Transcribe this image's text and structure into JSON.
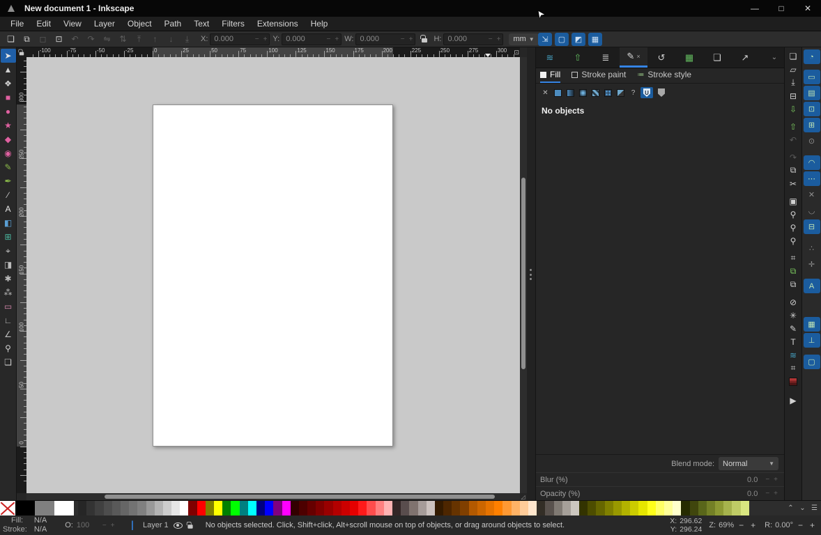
{
  "window": {
    "title": "New document 1 - Inkscape",
    "controls": [
      {
        "name": "minimize-button",
        "glyph": "—"
      },
      {
        "name": "maximize-button",
        "glyph": "□"
      },
      {
        "name": "close-button",
        "glyph": "✕"
      }
    ]
  },
  "menubar": {
    "items": [
      "File",
      "Edit",
      "View",
      "Layer",
      "Object",
      "Path",
      "Text",
      "Filters",
      "Extensions",
      "Help"
    ]
  },
  "toolbar": {
    "buttons": [
      {
        "name": "select-all-button",
        "glyph": "❏",
        "enabled": true
      },
      {
        "name": "select-all-layers-button",
        "glyph": "⧉",
        "enabled": true
      },
      {
        "name": "deselect-button",
        "glyph": "◻",
        "enabled": false
      },
      {
        "name": "select-touch-button",
        "glyph": "⊡",
        "enabled": true
      },
      {
        "name": "rotate-ccw-button",
        "glyph": "↶",
        "enabled": false
      },
      {
        "name": "rotate-cw-button",
        "glyph": "↷",
        "enabled": false
      },
      {
        "name": "flip-horizontal-button",
        "glyph": "⇋",
        "enabled": false
      },
      {
        "name": "flip-vertical-button",
        "glyph": "⇅",
        "enabled": false
      },
      {
        "name": "raise-top-button",
        "glyph": "⤒",
        "enabled": false
      },
      {
        "name": "raise-button",
        "glyph": "↑",
        "enabled": false
      },
      {
        "name": "lower-button",
        "glyph": "↓",
        "enabled": false
      },
      {
        "name": "lower-bottom-button",
        "glyph": "⤓",
        "enabled": false
      }
    ],
    "x_label": "X:",
    "x_value": "0.000",
    "y_label": "Y:",
    "y_value": "0.000",
    "w_label": "W:",
    "w_value": "0.000",
    "h_label": "H:",
    "h_value": "0.000",
    "units": "mm",
    "transform_toggles": [
      {
        "name": "scale-stroke-toggle",
        "glyph": "⇲"
      },
      {
        "name": "scale-corners-toggle",
        "glyph": "▢"
      },
      {
        "name": "move-gradients-toggle",
        "glyph": "◩"
      },
      {
        "name": "move-patterns-toggle",
        "glyph": "▦"
      }
    ]
  },
  "toolbox": {
    "tools": [
      {
        "name": "selector-tool",
        "glyph": "➤",
        "color": "#e3e3e3",
        "active": true
      },
      {
        "name": "node-editor-tool",
        "glyph": "▲",
        "color": "#d0d0d0",
        "active": false
      },
      {
        "name": "shape-builder-tool",
        "glyph": "❖",
        "color": "#d0d0d0",
        "active": false
      },
      {
        "name": "rectangle-tool",
        "glyph": "■",
        "color": "#e061a1",
        "active": false
      },
      {
        "name": "ellipse-tool",
        "glyph": "●",
        "color": "#e061a1",
        "active": false
      },
      {
        "name": "star-tool",
        "glyph": "★",
        "color": "#e061a1",
        "active": false
      },
      {
        "name": "box-3d-tool",
        "glyph": "◆",
        "color": "#e061a1",
        "active": false
      },
      {
        "name": "spiral-tool",
        "glyph": "◉",
        "color": "#e061a1",
        "active": false
      },
      {
        "name": "pencil-tool",
        "glyph": "✎",
        "color": "#8ab94a",
        "active": false
      },
      {
        "name": "pen-tool",
        "glyph": "✒",
        "color": "#8ab94a",
        "active": false
      },
      {
        "name": "calligraphy-tool",
        "glyph": "∕",
        "color": "#d0d0d0",
        "active": false
      },
      {
        "name": "text-tool",
        "glyph": "A",
        "color": "#e8e8e8",
        "active": false
      },
      {
        "name": "gradient-tool",
        "glyph": "◧",
        "color": "#5a9fd4",
        "active": false
      },
      {
        "name": "mesh-tool",
        "glyph": "⊞",
        "color": "#4ab9a0",
        "active": false
      },
      {
        "name": "dropper-tool",
        "glyph": "⌖",
        "color": "#d0d0d0",
        "active": false
      },
      {
        "name": "paint-bucket-tool",
        "glyph": "◨",
        "color": "#bcbcbc",
        "active": false
      },
      {
        "name": "tweak-tool",
        "glyph": "✱",
        "color": "#bcbcbc",
        "active": false
      },
      {
        "name": "spray-tool",
        "glyph": "⁂",
        "color": "#bcbcbc",
        "active": false
      },
      {
        "name": "eraser-tool",
        "glyph": "▭",
        "color": "#d78ab0",
        "active": false
      },
      {
        "name": "connector-tool",
        "glyph": "∟",
        "color": "#bcbcbc",
        "active": false
      },
      {
        "name": "measure-tool",
        "glyph": "∠",
        "color": "#bcbcbc",
        "active": false
      },
      {
        "name": "zoom-tool",
        "glyph": "⚲",
        "color": "#d0d0d0",
        "active": false
      },
      {
        "name": "pages-tool",
        "glyph": "❏",
        "color": "#d0d0d0",
        "active": false
      }
    ]
  },
  "rulers": {
    "unit": "mm",
    "h_labels": [
      "-100",
      "-75",
      "-50",
      "-25",
      "0",
      "25",
      "50",
      "75",
      "100",
      "125",
      "150",
      "175",
      "200",
      "225",
      "250",
      "275",
      "300"
    ],
    "v_labels": [
      "300",
      "250",
      "200",
      "150",
      "100",
      "50",
      "0"
    ]
  },
  "dock": {
    "dialog_tabs": [
      {
        "name": "tab-objects-dialog",
        "glyph": "≋",
        "color": "#46a0c0",
        "active": false
      },
      {
        "name": "tab-export-dialog",
        "glyph": "⇧",
        "color": "#62b95e",
        "active": false
      },
      {
        "name": "tab-align-distribute-dialog",
        "glyph": "≣",
        "color": "#d0d0d0",
        "active": false
      },
      {
        "name": "tab-fill-stroke-dialog",
        "glyph": "✎",
        "color": "#d8d8d8",
        "active": true,
        "closable": true
      },
      {
        "name": "tab-undo-history-dialog",
        "glyph": "↺",
        "color": "#d0d0d0",
        "active": false
      },
      {
        "name": "tab-transform-dialog",
        "glyph": "▦",
        "color": "#62b95e",
        "active": false
      },
      {
        "name": "tab-document-properties-dialog",
        "glyph": "❏",
        "color": "#d0d0d0",
        "active": false
      },
      {
        "name": "tab-symbols-dialog",
        "glyph": "↗",
        "color": "#d0d0d0",
        "active": false
      }
    ],
    "close_glyph": "×",
    "more_tabs_glyph": "⌄",
    "fill_stroke": {
      "tabs": [
        {
          "name": "tab-fill",
          "label": "Fill",
          "active": true,
          "icon": "filled-square-icon"
        },
        {
          "name": "tab-stroke-paint",
          "label": "Stroke paint",
          "active": false,
          "icon": "outline-square-icon"
        },
        {
          "name": "tab-stroke-style",
          "label": "Stroke style",
          "active": false,
          "icon": "stroke-lines-icon"
        }
      ],
      "paint_buttons": [
        {
          "name": "paint-none-button",
          "kind": "glyph",
          "glyph": "✕"
        },
        {
          "name": "paint-flat-button",
          "kind": "swatch",
          "css": "pb-flat"
        },
        {
          "name": "paint-linear-gradient-button",
          "kind": "swatch",
          "css": "pb-lin"
        },
        {
          "name": "paint-radial-gradient-button",
          "kind": "swatch",
          "css": "pb-rad"
        },
        {
          "name": "paint-pattern-button",
          "kind": "swatch",
          "css": "pb-pat"
        },
        {
          "name": "paint-mesh-gradient-button",
          "kind": "swatch",
          "css": "pb-mesh"
        },
        {
          "name": "paint-swatch-button",
          "kind": "swatch",
          "css": "pb-sw"
        },
        {
          "name": "paint-unknown-button",
          "kind": "glyph",
          "glyph": "?"
        },
        {
          "name": "fill-rule-evenodd-button",
          "kind": "shield",
          "glyph": "U",
          "active": true
        },
        {
          "name": "fill-rule-nonzero-button",
          "kind": "shield",
          "glyph": "",
          "active": false
        }
      ],
      "message": "No objects",
      "blend_mode_label": "Blend mode:",
      "blend_mode_value": "Normal",
      "blur_label": "Blur (%)",
      "blur_value": "0.0",
      "opacity_label": "Opacity (%)",
      "opacity_value": "0.0"
    }
  },
  "commands_bar": {
    "buttons": [
      {
        "name": "new-document-button",
        "glyph": "❏",
        "enabled": true
      },
      {
        "name": "open-document-button",
        "glyph": "▱",
        "enabled": true
      },
      {
        "name": "save-document-button",
        "glyph": "⤓",
        "enabled": true
      },
      {
        "name": "print-button",
        "glyph": "⊟",
        "enabled": true
      },
      {
        "name": "import-button",
        "glyph": "⇩",
        "enabled": true,
        "color": "#7bc95e"
      },
      {
        "name": "export-button",
        "glyph": "⇧",
        "enabled": true,
        "color": "#7bc95e",
        "gap": 6
      },
      {
        "name": "undo-button",
        "glyph": "↶",
        "enabled": false
      },
      {
        "name": "redo-button",
        "glyph": "↷",
        "enabled": false,
        "gap": 6
      },
      {
        "name": "copy-button",
        "glyph": "⧉",
        "enabled": true
      },
      {
        "name": "cut-button",
        "glyph": "✂",
        "enabled": true
      },
      {
        "name": "paste-button",
        "glyph": "▣",
        "enabled": true,
        "gap": 6
      },
      {
        "name": "zoom-selection-button",
        "glyph": "⚲",
        "enabled": true
      },
      {
        "name": "zoom-drawing-button",
        "glyph": "⚲",
        "enabled": true
      },
      {
        "name": "zoom-page-button",
        "glyph": "⚲",
        "enabled": true
      },
      {
        "name": "zoom-center-page-button",
        "glyph": "⌗",
        "enabled": true,
        "gap": 6
      },
      {
        "name": "duplicate-button",
        "glyph": "⧉",
        "enabled": true,
        "color": "#7bc95e"
      },
      {
        "name": "create-clone-button",
        "glyph": "⧉",
        "enabled": true
      },
      {
        "name": "unlink-clone-button",
        "glyph": "⊘",
        "enabled": true,
        "gap": 6
      },
      {
        "name": "preferences-button",
        "glyph": "✳",
        "enabled": true
      },
      {
        "name": "fill-stroke-dialog-button",
        "glyph": "✎",
        "enabled": true
      },
      {
        "name": "text-dialog-button",
        "glyph": "T",
        "enabled": true
      },
      {
        "name": "layers-dialog-button",
        "glyph": "≋",
        "enabled": true,
        "color": "#46a0c0"
      },
      {
        "name": "xml-editor-button",
        "glyph": "⌗",
        "enabled": true
      },
      {
        "name": "swatches-dialog-button",
        "glyph": "",
        "enabled": true,
        "css": "sw-colored"
      },
      {
        "name": "expand-commands-button",
        "glyph": "▶",
        "enabled": true,
        "gap": 8
      }
    ]
  },
  "snap_bar": {
    "buttons": [
      {
        "name": "snap-global-toggle",
        "glyph": "◔",
        "active": true,
        "gap": 8
      },
      {
        "name": "snap-bounding-box-toggle",
        "glyph": "▭",
        "active": true
      },
      {
        "name": "snap-bbox-edges-toggle",
        "glyph": "▤",
        "active": true
      },
      {
        "name": "snap-bbox-corners-toggle",
        "glyph": "⊡",
        "active": true
      },
      {
        "name": "snap-bbox-midpoints-toggle",
        "glyph": "⊞",
        "active": true
      },
      {
        "name": "snap-bbox-centers-toggle",
        "glyph": "⊙",
        "active": false,
        "gap": 10
      },
      {
        "name": "snap-nodes-toggle",
        "glyph": "◠",
        "active": true
      },
      {
        "name": "snap-path-intersections-toggle",
        "glyph": "⋯",
        "active": true
      },
      {
        "name": "snap-cusp-nodes-toggle",
        "glyph": "✕",
        "active": false
      },
      {
        "name": "snap-smooth-nodes-toggle",
        "glyph": "◡",
        "active": false
      },
      {
        "name": "snap-line-midpoints-toggle",
        "glyph": "⊟",
        "active": true,
        "gap": 10
      },
      {
        "name": "snap-object-centers-toggle",
        "glyph": "∴",
        "active": false
      },
      {
        "name": "snap-rotation-centers-toggle",
        "glyph": "✛",
        "active": false,
        "gap": 10
      },
      {
        "name": "snap-text-baseline-toggle",
        "glyph": "A",
        "active": true,
        "gap": 34
      },
      {
        "name": "snap-grid-toggle",
        "glyph": "▦",
        "active": true
      },
      {
        "name": "snap-guides-toggle",
        "glyph": "⊥",
        "active": true,
        "gap": 10
      },
      {
        "name": "snap-page-border-toggle",
        "glyph": "▢",
        "active": true
      }
    ]
  },
  "palette": {
    "large_swatches": [
      "#000000",
      "#808080",
      "#ffffff"
    ],
    "colors": [
      "#262626",
      "#333333",
      "#404040",
      "#4d4d4d",
      "#595959",
      "#666666",
      "#737373",
      "#808080",
      "#999999",
      "#b3b3b3",
      "#cccccc",
      "#e6e6e6",
      "#ffffff",
      "#800000",
      "#ff0000",
      "#808000",
      "#ffff00",
      "#008000",
      "#00ff00",
      "#008080",
      "#00ffff",
      "#000080",
      "#0000ff",
      "#800080",
      "#ff00ff",
      "#330000",
      "#4d0000",
      "#660000",
      "#800000",
      "#990000",
      "#b30000",
      "#cc0000",
      "#e60000",
      "#ff1a1a",
      "#ff4d4d",
      "#ff8080",
      "#ffb3b3",
      "#332626",
      "#594d4d",
      "#80736f",
      "#a69c99",
      "#ccc2bf",
      "#331a00",
      "#4d2600",
      "#663300",
      "#803f00",
      "#b35900",
      "#cc6600",
      "#e67300",
      "#ff8000",
      "#ff9933",
      "#ffb366",
      "#ffcc99",
      "#ffe6cc",
      "#332e26",
      "#59524d",
      "#807a73",
      "#a6a099",
      "#ccc7bf",
      "#333300",
      "#4d4d00",
      "#666600",
      "#808000",
      "#999900",
      "#b3b300",
      "#cccc00",
      "#e6e600",
      "#ffff1a",
      "#ffff66",
      "#ffff99",
      "#ffffcc",
      "#262b00",
      "#40460d",
      "#59661a",
      "#738026",
      "#8c9933",
      "#a6b34d",
      "#bfcc66",
      "#d9e680"
    ],
    "controls": [
      {
        "name": "palette-scroll-up-button",
        "glyph": "⌃"
      },
      {
        "name": "palette-scroll-down-button",
        "glyph": "⌄"
      },
      {
        "name": "palette-menu-button",
        "glyph": "☰"
      }
    ]
  },
  "statusbar": {
    "fill_label": "Fill:",
    "fill_value": "N/A",
    "stroke_label": "Stroke:",
    "stroke_value": "N/A",
    "opacity_label": "O:",
    "opacity_value": "100",
    "layer_label": "Layer 1",
    "message": "No objects selected. Click, Shift+click, Alt+scroll mouse on top of objects, or drag around objects to select.",
    "x_label": "X:",
    "x_value": "296.62",
    "y_label": "Y:",
    "y_value": "296.24",
    "zoom_label": "Z:",
    "zoom_value": "69%",
    "rotation_label": "R:",
    "rotation_value": "0.00°"
  },
  "colors": {
    "accent": "#3584e4",
    "snap_active": "#1b5c9e",
    "canvas_bg": "#c9c9c9",
    "page_bg": "#ffffff"
  }
}
